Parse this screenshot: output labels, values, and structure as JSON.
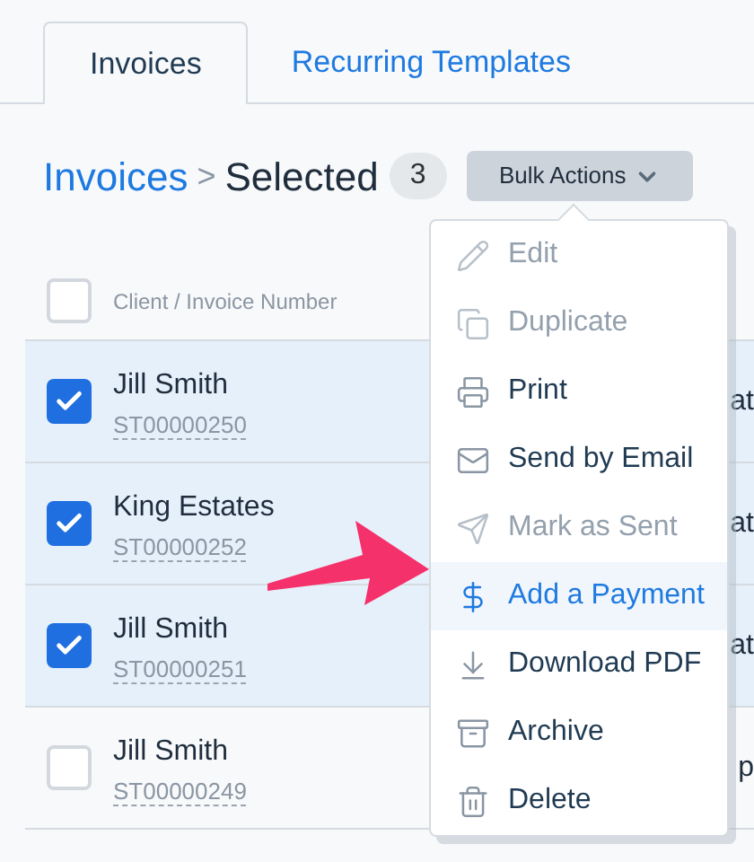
{
  "tabs": [
    {
      "label": "Invoices",
      "selected": true
    },
    {
      "label": "Recurring Templates",
      "selected": false
    }
  ],
  "breadcrumb": {
    "link": "Invoices",
    "separator": ">",
    "current": "Selected",
    "count": "3"
  },
  "bulk_actions": {
    "label": "Bulk Actions",
    "expanded": true
  },
  "table": {
    "header": {
      "checked": false,
      "column_1": "Client / Invoice Number"
    },
    "rows": [
      {
        "client": "Jill Smith",
        "number": "ST00000250",
        "checked": true,
        "column_2": "at"
      },
      {
        "client": "King Estates",
        "number": "ST00000252",
        "checked": true,
        "column_2": "at"
      },
      {
        "client": "Jill Smith",
        "number": "ST00000251",
        "checked": true,
        "column_2": "at"
      },
      {
        "client": "Jill Smith",
        "number": "ST00000249",
        "checked": false,
        "column_2": "p"
      }
    ]
  },
  "menu": [
    {
      "label": "Edit",
      "disabled": true,
      "selected": false
    },
    {
      "label": "Duplicate",
      "disabled": true,
      "selected": false
    },
    {
      "label": "Print",
      "disabled": false,
      "selected": false
    },
    {
      "label": "Send by Email",
      "disabled": false,
      "selected": false
    },
    {
      "label": "Mark as Sent",
      "disabled": true,
      "selected": false
    },
    {
      "label": "Add a Payment",
      "disabled": false,
      "selected": true
    },
    {
      "label": "Download PDF",
      "disabled": false,
      "selected": false
    },
    {
      "label": "Archive",
      "disabled": false,
      "selected": false
    },
    {
      "label": "Delete",
      "disabled": false,
      "selected": false
    }
  ]
}
